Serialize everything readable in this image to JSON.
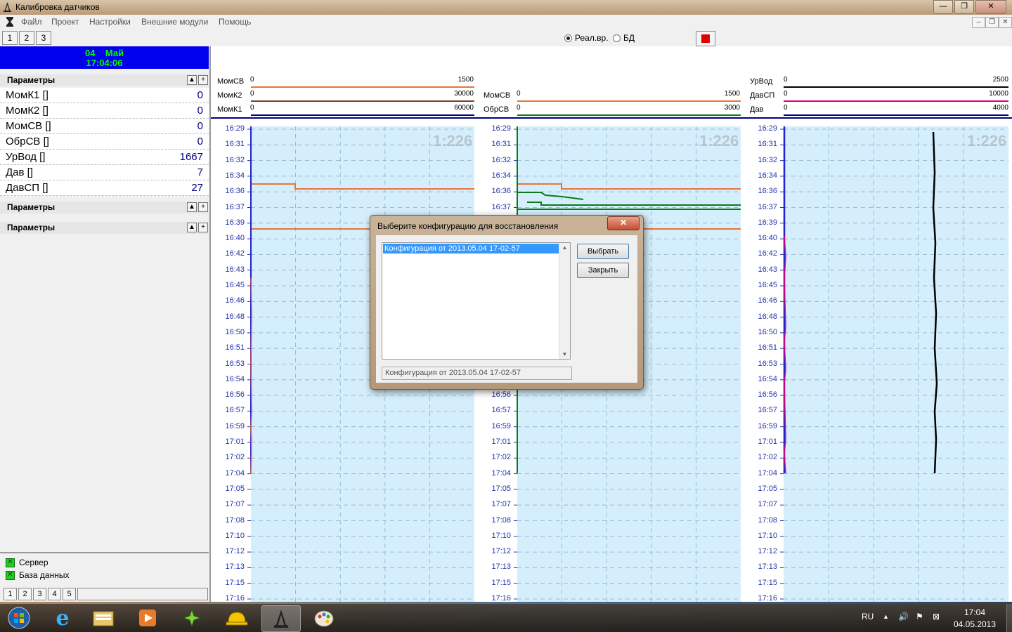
{
  "window": {
    "title": "Калибровка датчиков",
    "controls": {
      "minimize": "—",
      "maximize": "❐",
      "close": "✕"
    }
  },
  "menu": {
    "items": [
      "Файл",
      "Проект",
      "Настройки",
      "Внешние модули",
      "Помощь"
    ],
    "mdi_controls": {
      "minimize": "–",
      "restore": "❐",
      "close": "✕"
    }
  },
  "toolbar": {
    "tabs": [
      "1",
      "2",
      "3"
    ],
    "radio_realtime": "Реал.вр.",
    "radio_db": "БД",
    "mode_selected": "realtime",
    "stop_color": "#e00000"
  },
  "left_panel": {
    "date_line1": "04    Май",
    "date_line2": "17:04:06",
    "sections": [
      {
        "title": "Параметры"
      },
      {
        "title": "Параметры"
      },
      {
        "title": "Параметры"
      }
    ],
    "params": [
      {
        "name": "МомК1 []",
        "value": "0"
      },
      {
        "name": "МомК2 []",
        "value": "0"
      },
      {
        "name": "МомСВ []",
        "value": "0"
      },
      {
        "name": "ОбрСВ []",
        "value": "0"
      },
      {
        "name": "УрВод []",
        "value": "1667"
      },
      {
        "name": "Дав []",
        "value": "7"
      },
      {
        "name": "ДавСП []",
        "value": "27"
      }
    ],
    "status": {
      "server": "Сервер",
      "database": "База данных"
    },
    "bottom_tabs": [
      "1",
      "2",
      "3",
      "4",
      "5"
    ]
  },
  "charts": {
    "ratio_label": "1:226",
    "time_labels": [
      "16:29",
      "16:31",
      "16:32",
      "16:34",
      "16:36",
      "16:37",
      "16:39",
      "16:40",
      "16:42",
      "16:43",
      "16:45",
      "16:46",
      "16:48",
      "16:50",
      "16:51",
      "16:53",
      "16:54",
      "16:56",
      "16:57",
      "16:59",
      "17:01",
      "17:02",
      "17:04",
      "17:05",
      "17:07",
      "17:08",
      "17:10",
      "17:12",
      "17:13",
      "17:15",
      "17:16"
    ],
    "panels": [
      {
        "scales": [
          {
            "name": "МомСВ",
            "min": "0",
            "max": "1500",
            "color": "#e8743b"
          },
          {
            "name": "МомК2",
            "min": "0",
            "max": "30000",
            "color": "#7a3f2a"
          },
          {
            "name": "МомК1",
            "min": "0",
            "max": "60000",
            "color": "#000080"
          }
        ]
      },
      {
        "scales": [
          {
            "name": "МомСВ",
            "min": "0",
            "max": "1500",
            "color": "#e8743b"
          },
          {
            "name": "ОбрСВ",
            "min": "0",
            "max": "3000",
            "color": "#0a7a1a"
          }
        ]
      },
      {
        "scales": [
          {
            "name": "УрВод",
            "min": "0",
            "max": "2500",
            "color": "#000000"
          },
          {
            "name": "ДавСП",
            "min": "0",
            "max": "10000",
            "color": "#e0007a"
          },
          {
            "name": "Дав",
            "min": "0",
            "max": "4000",
            "color": "#000080"
          }
        ]
      }
    ]
  },
  "dialog": {
    "title": "Выберите конфигурацию для восстановления",
    "close": "✕",
    "list_items": [
      "Конфигурация от 2013.05.04 17-02-57"
    ],
    "select_button": "Выбрать",
    "close_button": "Закрыть",
    "selected_field": "Конфигурация от 2013.05.04 17-02-57"
  },
  "taskbar": {
    "apps": [
      {
        "icon": "start-orb-icon",
        "glyph": "◉"
      },
      {
        "icon": "internet-explorer-icon",
        "glyph": "e"
      },
      {
        "icon": "file-explorer-icon",
        "glyph": "▤"
      },
      {
        "icon": "media-player-icon",
        "glyph": "▶"
      },
      {
        "icon": "tool-app-icon",
        "glyph": "✦"
      },
      {
        "icon": "hardhat-app-icon",
        "glyph": "◒"
      },
      {
        "icon": "drilling-rig-icon",
        "glyph": "⍋"
      },
      {
        "icon": "paint-icon",
        "glyph": "✎"
      }
    ],
    "language": "RU",
    "time": "17:04",
    "date": "04.05.2013"
  }
}
